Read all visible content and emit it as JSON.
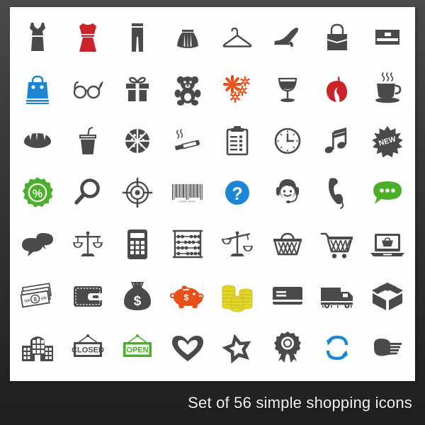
{
  "poster": {
    "caption": "Set of 56 simple shopping icons",
    "icon_count": 56,
    "grid": {
      "columns": 8,
      "rows": 7
    },
    "colors": {
      "background_dark": "#2b2b2b",
      "canvas": "#fdfdfd",
      "icon_default": "#4a4a4a",
      "red": "#cc2229",
      "blue": "#1b87d4",
      "green": "#4caf2a",
      "orange": "#e8501a",
      "gold": "#e3d629",
      "caption_text": "#f2f2f2"
    }
  },
  "icons": [
    {
      "name": "dress-icon",
      "label": "Dress",
      "color": "#4a4a4a"
    },
    {
      "name": "red-dress-icon",
      "label": "Red dress",
      "color": "#cc2229"
    },
    {
      "name": "trousers-icon",
      "label": "Trousers",
      "color": "#4a4a4a"
    },
    {
      "name": "skirt-icon",
      "label": "Skirt",
      "color": "#4a4a4a"
    },
    {
      "name": "clothes-hanger-icon",
      "label": "Clothes hanger",
      "color": "#4a4a4a"
    },
    {
      "name": "high-heel-shoe-icon",
      "label": "High heel shoe",
      "color": "#4a4a4a"
    },
    {
      "name": "handbag-icon",
      "label": "Handbag",
      "color": "#4a4a4a"
    },
    {
      "name": "wallet-purse-icon",
      "label": "Wallet",
      "color": "#4a4a4a"
    },
    {
      "name": "shopping-bag-icon",
      "label": "Shopping bag",
      "color": "#1b87d4"
    },
    {
      "name": "eyeglasses-icon",
      "label": "Eyeglasses",
      "color": "#4a4a4a"
    },
    {
      "name": "gift-box-icon",
      "label": "Gift box",
      "color": "#4a4a4a"
    },
    {
      "name": "teddy-bear-icon",
      "label": "Teddy bear",
      "color": "#4a4a4a"
    },
    {
      "name": "flowers-icon",
      "label": "Flowers",
      "color": "#e8501a"
    },
    {
      "name": "wine-glass-icon",
      "label": "Wine glass",
      "color": "#4a4a4a"
    },
    {
      "name": "pomegranate-icon",
      "label": "Pomegranate",
      "color": "#cc2229"
    },
    {
      "name": "coffee-cup-icon",
      "label": "Coffee cup",
      "color": "#4a4a4a"
    },
    {
      "name": "bread-loaf-icon",
      "label": "Bread",
      "color": "#4a4a4a"
    },
    {
      "name": "soda-cup-icon",
      "label": "Soda cup",
      "color": "#4a4a4a"
    },
    {
      "name": "pizza-icon",
      "label": "Pizza",
      "color": "#4a4a4a"
    },
    {
      "name": "cigarette-icon",
      "label": "Cigarette",
      "color": "#4a4a4a"
    },
    {
      "name": "clipboard-list-icon",
      "label": "Clipboard",
      "color": "#4a4a4a"
    },
    {
      "name": "clock-icon",
      "label": "Clock",
      "color": "#4a4a4a"
    },
    {
      "name": "music-note-icon",
      "label": "Music note",
      "color": "#4a4a4a"
    },
    {
      "name": "new-badge-icon",
      "label": "New badge",
      "color": "#4a4a4a",
      "text": "NEW"
    },
    {
      "name": "discount-badge-icon",
      "label": "Discount badge",
      "color": "#4caf2a",
      "text": "%"
    },
    {
      "name": "magnifier-icon",
      "label": "Magnifier",
      "color": "#4a4a4a"
    },
    {
      "name": "target-icon",
      "label": "Target",
      "color": "#4a4a4a"
    },
    {
      "name": "barcode-icon",
      "label": "Barcode",
      "color": "#4a4a4a",
      "text": "9  28997  38752"
    },
    {
      "name": "question-mark-icon",
      "label": "Question mark",
      "color": "#1b87d4",
      "text": "?"
    },
    {
      "name": "support-agent-icon",
      "label": "Support agent",
      "color": "#4a4a4a"
    },
    {
      "name": "phone-handset-icon",
      "label": "Phone handset",
      "color": "#4a4a4a"
    },
    {
      "name": "chat-bubble-icon",
      "label": "Chat bubble",
      "color": "#4caf2a"
    },
    {
      "name": "speech-bubbles-icon",
      "label": "Speech bubbles",
      "color": "#4a4a4a"
    },
    {
      "name": "balance-scales-icon",
      "label": "Balance scales",
      "color": "#4a4a4a"
    },
    {
      "name": "calculator-icon",
      "label": "Calculator",
      "color": "#4a4a4a"
    },
    {
      "name": "abacus-icon",
      "label": "Abacus",
      "color": "#4a4a4a"
    },
    {
      "name": "unbalanced-scales-icon",
      "label": "Unbalanced scales",
      "color": "#4a4a4a"
    },
    {
      "name": "shopping-basket-icon",
      "label": "Shopping basket",
      "color": "#4a4a4a"
    },
    {
      "name": "shopping-cart-icon",
      "label": "Shopping cart",
      "color": "#4a4a4a"
    },
    {
      "name": "laptop-shopping-icon",
      "label": "Online shopping",
      "color": "#4a4a4a"
    },
    {
      "name": "banknotes-icon",
      "label": "Banknotes",
      "color": "#4a4a4a",
      "text": "100"
    },
    {
      "name": "wallet-icon",
      "label": "Wallet",
      "color": "#4a4a4a"
    },
    {
      "name": "money-bag-icon",
      "label": "Money bag",
      "color": "#4a4a4a",
      "text": "$"
    },
    {
      "name": "piggy-bank-icon",
      "label": "Piggy bank",
      "color": "#e8501a",
      "text": "$"
    },
    {
      "name": "coin-stacks-icon",
      "label": "Coin stacks",
      "color": "#e3d629"
    },
    {
      "name": "credit-card-icon",
      "label": "Credit card",
      "color": "#4a4a4a"
    },
    {
      "name": "delivery-truck-icon",
      "label": "Delivery truck",
      "color": "#4a4a4a"
    },
    {
      "name": "open-box-icon",
      "label": "Open box",
      "color": "#4a4a4a"
    },
    {
      "name": "shopping-mall-icon",
      "label": "Shopping mall",
      "color": "#4a4a4a"
    },
    {
      "name": "closed-sign-icon",
      "label": "Closed sign",
      "color": "#4a4a4a",
      "text": "CLOSED"
    },
    {
      "name": "open-sign-icon",
      "label": "Open sign",
      "color": "#4caf2a",
      "text": "OPEN"
    },
    {
      "name": "heart-icon",
      "label": "Heart",
      "color": "#4a4a4a"
    },
    {
      "name": "star-icon",
      "label": "Star",
      "color": "#4a4a4a"
    },
    {
      "name": "award-ribbon-icon",
      "label": "Award ribbon",
      "color": "#4a4a4a"
    },
    {
      "name": "refresh-arrows-icon",
      "label": "Refresh",
      "color": "#1b87d4"
    },
    {
      "name": "pointing-hand-icon",
      "label": "Pointing hand",
      "color": "#4a4a4a"
    }
  ]
}
